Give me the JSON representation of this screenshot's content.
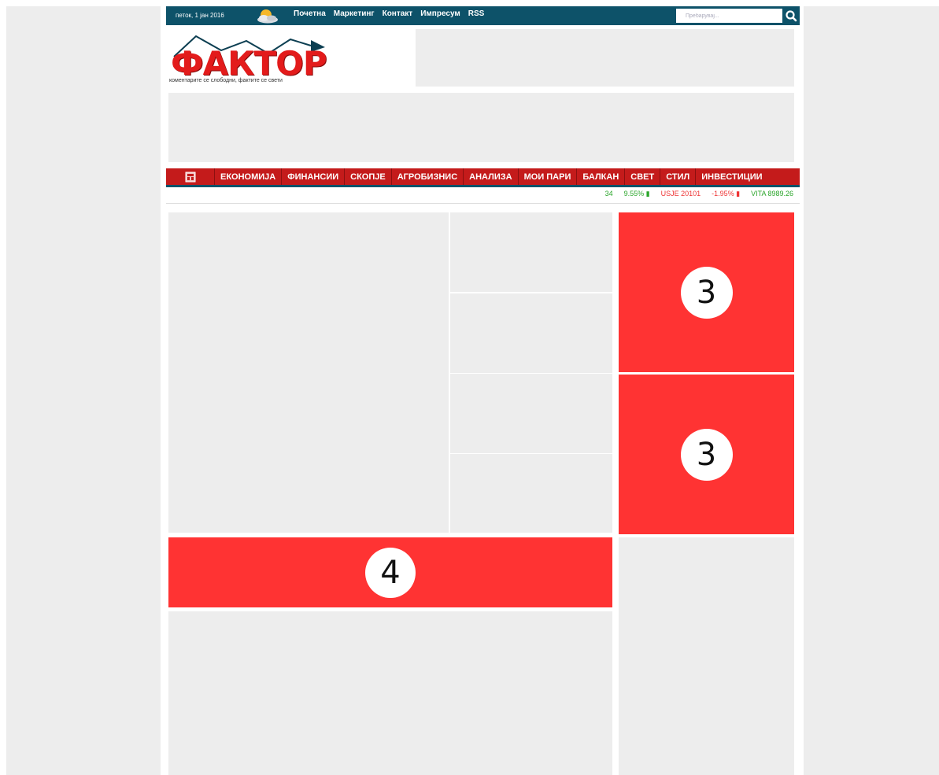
{
  "topbar": {
    "date": "петок, 1 јан 2016",
    "weather_icon": "cloud-sun-icon",
    "nav": [
      "Почетна",
      "Маркетинг",
      "Контакт",
      "Импресум",
      "RSS"
    ],
    "search_placeholder": "Пребарувај...",
    "search_icon": "search-icon",
    "bg_color": "#0d5269"
  },
  "header": {
    "logo_text": "ФАКТОР",
    "logo_tagline": "коментарите се слободни, фактите се свети",
    "logo_color": "#e31b1b"
  },
  "mainnav": {
    "home_icon": "home-icon",
    "items": [
      "ЕКОНОМИЈА",
      "ФИНАНСИИ",
      "СКОПЈЕ",
      "АГРОБИЗНИС",
      "АНАЛИЗА",
      "МОИ ПАРИ",
      "БАЛКАН",
      "СВЕТ",
      "СТИЛ",
      "ИНВЕСТИЦИИ"
    ],
    "bg_color": "#c41b1b"
  },
  "ticker": {
    "items": [
      {
        "text": "34",
        "trend": "up"
      },
      {
        "text": "9.55%",
        "trend": "up"
      },
      {
        "text": "USJE 20101",
        "trend": "down"
      },
      {
        "text": "-1.95%",
        "trend": "down"
      },
      {
        "text": "VITA 8989.26",
        "trend": "up"
      }
    ]
  },
  "ads": {
    "slot_3a": "3",
    "slot_3b": "3",
    "slot_4": "4",
    "color": "#ff3333"
  }
}
